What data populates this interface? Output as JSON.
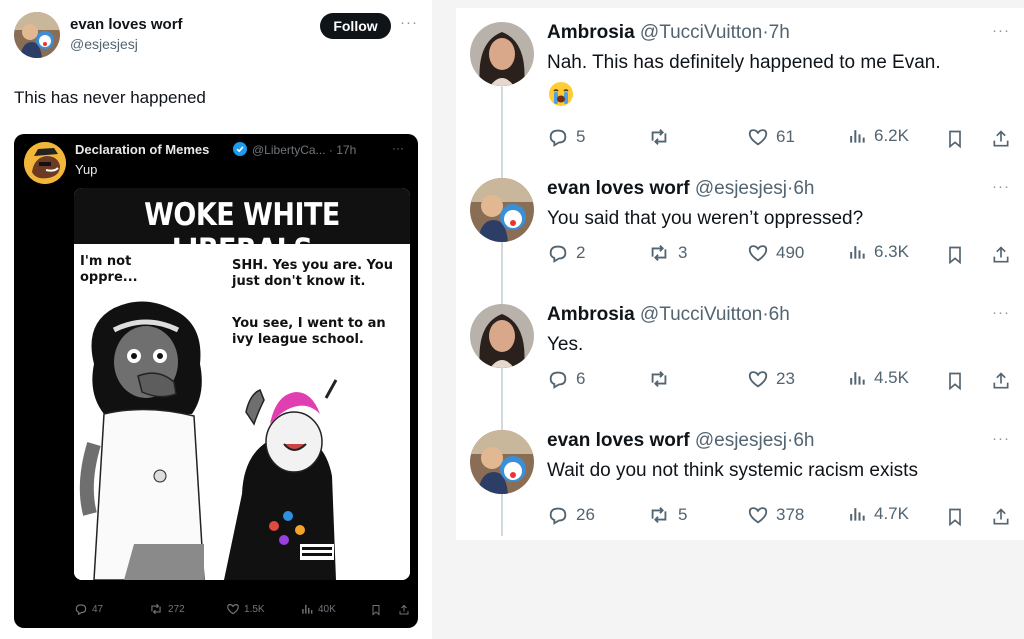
{
  "left_post": {
    "author_name": "evan loves worf",
    "author_handle": "@esjesjesj",
    "follow_label": "Follow",
    "more": "···",
    "text": "This has never happened",
    "quoted": {
      "author_name": "Declaration of Memes",
      "author_handle": "@LibertyCa...",
      "time": "· 17h",
      "more": "···",
      "text": "Yup",
      "meme": {
        "title": "WOKE WHITE LIBERALS",
        "bubble_left": "I'm not\noppre...",
        "bubble_right_1": "SHH. Yes you are. You\njust don't know it.",
        "bubble_right_2": "You see, I went to an\nivy league school."
      },
      "stats": {
        "replies": "47",
        "reposts": "272",
        "likes": "1.5K",
        "views": "40K"
      }
    }
  },
  "thread": [
    {
      "name": "Ambrosia",
      "handle": "@TucciVuitton",
      "time": "·7h",
      "text": "Nah. This has definitely happened to me Evan.",
      "emoji": "crying-face-icon",
      "replies": "5",
      "reposts": "",
      "likes": "61",
      "views": "6.2K"
    },
    {
      "name": "evan loves worf",
      "handle": "@esjesjesj",
      "time": "·6h",
      "text": "You said that you weren’t oppressed?",
      "replies": "2",
      "reposts": "3",
      "likes": "490",
      "views": "6.3K"
    },
    {
      "name": "Ambrosia",
      "handle": "@TucciVuitton",
      "time": "·6h",
      "text": "Yes.",
      "replies": "6",
      "reposts": "",
      "likes": "23",
      "views": "4.5K"
    },
    {
      "name": "evan loves worf",
      "handle": "@esjesjesj",
      "time": "·6h",
      "text": "Wait do you not think systemic racism exists",
      "replies": "26",
      "reposts": "5",
      "likes": "378",
      "views": "4.7K"
    }
  ],
  "thread_more": "···",
  "colors": {
    "accent": "#1d9bf0",
    "text": "#0f1419",
    "muted": "#536471",
    "dark_card": "#000000"
  }
}
